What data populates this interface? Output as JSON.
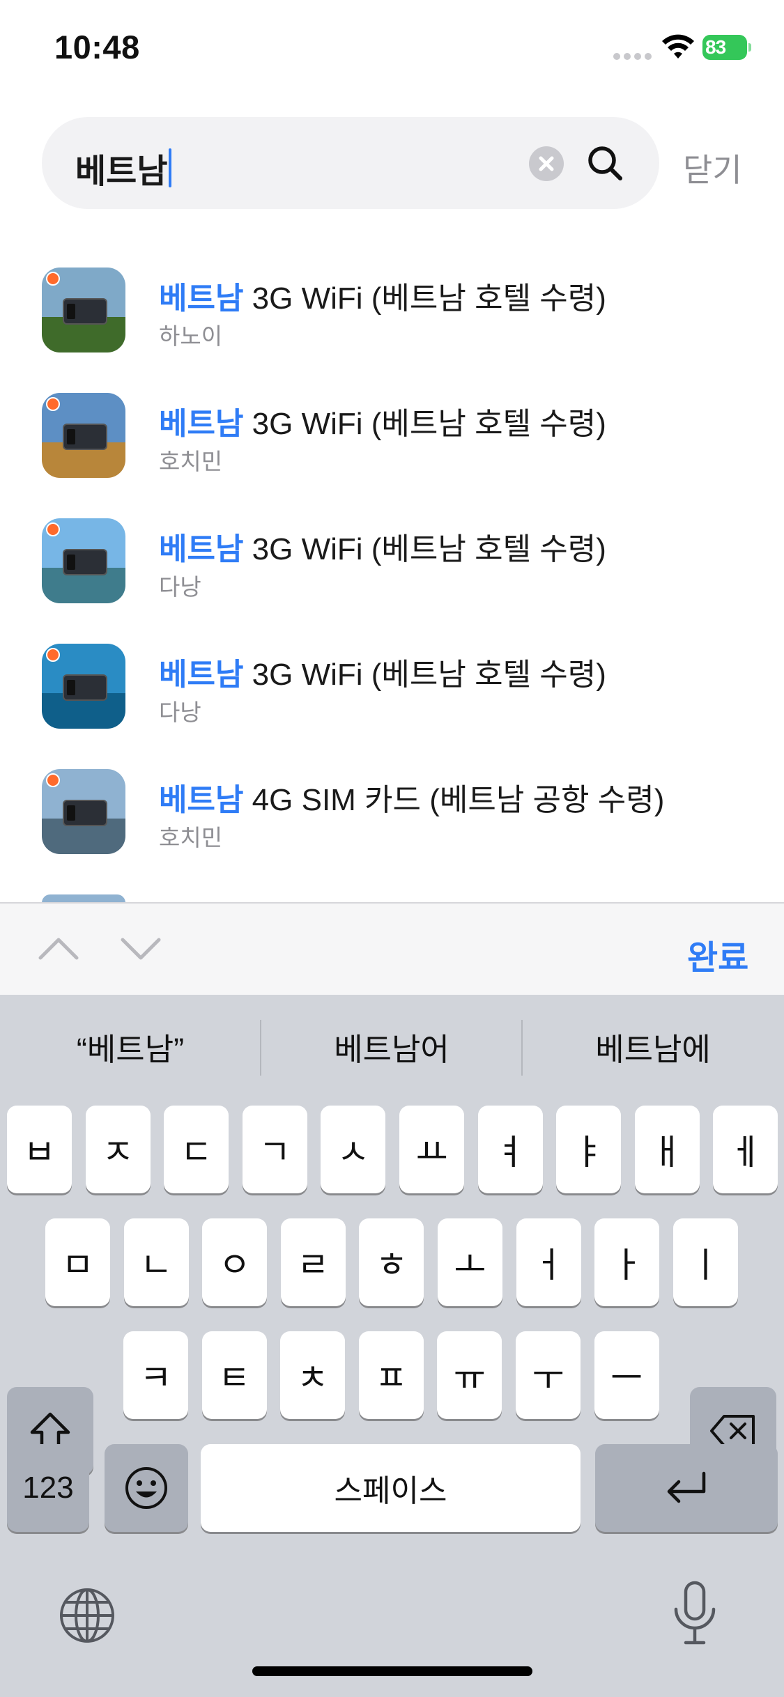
{
  "status_bar": {
    "time": "10:48",
    "battery": "83"
  },
  "search": {
    "query": "베트남",
    "close_label": "닫기"
  },
  "results": [
    {
      "highlight": "베트남",
      "title_rest": " 3G WiFi (베트남 호텔 수령)",
      "subtitle": "하노이",
      "sky": "#7fa9c8",
      "ground": "#3f6b2a"
    },
    {
      "highlight": "베트남",
      "title_rest": " 3G WiFi (베트남 호텔 수령)",
      "subtitle": "호치민",
      "sky": "#5d8fc4",
      "ground": "#b8863a"
    },
    {
      "highlight": "베트남",
      "title_rest": " 3G WiFi (베트남 호텔 수령)",
      "subtitle": "다낭",
      "sky": "#77b6e6",
      "ground": "#3f7c8c"
    },
    {
      "highlight": "베트남",
      "title_rest": " 3G WiFi (베트남 호텔 수령)",
      "subtitle": "다낭",
      "sky": "#2a8cc4",
      "ground": "#0f5f8a"
    },
    {
      "highlight": "베트남",
      "title_rest": " 4G SIM 카드 (베트남 공항 수령)",
      "subtitle": "호치민",
      "sky": "#8fb2d1",
      "ground": "#4f6a7d"
    }
  ],
  "accessory": {
    "done_label": "완료"
  },
  "keyboard": {
    "suggestions": [
      "“베트남”",
      "베트남어",
      "베트남에"
    ],
    "row1": [
      "ㅂ",
      "ㅈ",
      "ㄷ",
      "ㄱ",
      "ㅅ",
      "ㅛ",
      "ㅕ",
      "ㅑ",
      "ㅐ",
      "ㅔ"
    ],
    "row2": [
      "ㅁ",
      "ㄴ",
      "ㅇ",
      "ㄹ",
      "ㅎ",
      "ㅗ",
      "ㅓ",
      "ㅏ",
      "ㅣ"
    ],
    "row3": [
      "ㅋ",
      "ㅌ",
      "ㅊ",
      "ㅍ",
      "ㅠ",
      "ㅜ",
      "ㅡ"
    ],
    "numbers_label": "123",
    "space_label": "스페이스"
  },
  "colors": {
    "accent": "#2f7cf6",
    "battery": "#34c759",
    "keyboard_bg": "#d1d4da"
  }
}
